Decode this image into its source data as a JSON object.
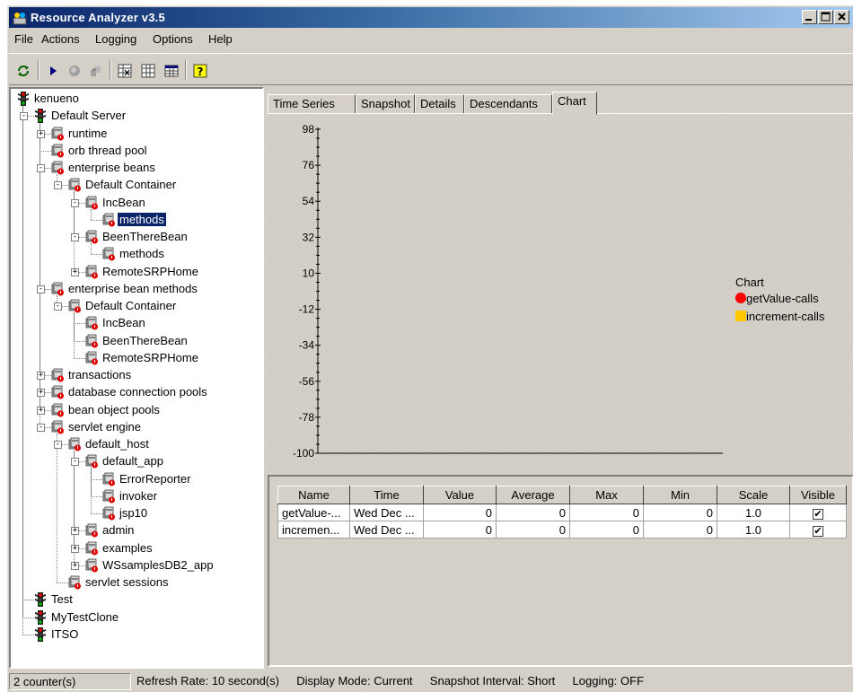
{
  "window": {
    "title": "Resource Analyzer v3.5"
  },
  "menu": [
    "File",
    "Actions",
    "Logging",
    "Options",
    "Help"
  ],
  "toolbar": [
    "refresh-icon",
    "play-icon",
    "stop-icon",
    "reset-icon",
    "table-icon",
    "table-clear-icon",
    "grid-icon",
    "help-icon"
  ],
  "tree": [
    {
      "label": "kenueno",
      "depth": 0,
      "icon": "traffic-light-icon",
      "expander": ""
    },
    {
      "label": "Default Server",
      "depth": 1,
      "icon": "traffic-light-icon",
      "expander": "-"
    },
    {
      "label": "runtime",
      "depth": 2,
      "icon": "resource-icon",
      "expander": "+"
    },
    {
      "label": "orb thread pool",
      "depth": 2,
      "icon": "resource-icon",
      "expander": ""
    },
    {
      "label": "enterprise beans",
      "depth": 2,
      "icon": "resource-icon",
      "expander": "-"
    },
    {
      "label": "Default Container",
      "depth": 3,
      "icon": "resource-icon",
      "expander": "-"
    },
    {
      "label": "IncBean",
      "depth": 4,
      "icon": "resource-icon",
      "expander": "-"
    },
    {
      "label": "methods",
      "depth": 5,
      "icon": "resource-icon",
      "expander": "",
      "selected": true
    },
    {
      "label": "BeenThereBean",
      "depth": 4,
      "icon": "resource-icon",
      "expander": "-"
    },
    {
      "label": "methods",
      "depth": 5,
      "icon": "resource-icon",
      "expander": ""
    },
    {
      "label": "RemoteSRPHome",
      "depth": 4,
      "icon": "resource-icon",
      "expander": "+"
    },
    {
      "label": "enterprise bean methods",
      "depth": 2,
      "icon": "resource-icon",
      "expander": "-"
    },
    {
      "label": "Default Container",
      "depth": 3,
      "icon": "resource-icon",
      "expander": "-"
    },
    {
      "label": "IncBean",
      "depth": 4,
      "icon": "resource-icon",
      "expander": ""
    },
    {
      "label": "BeenThereBean",
      "depth": 4,
      "icon": "resource-icon",
      "expander": ""
    },
    {
      "label": "RemoteSRPHome",
      "depth": 4,
      "icon": "resource-icon",
      "expander": ""
    },
    {
      "label": "transactions",
      "depth": 2,
      "icon": "resource-icon",
      "expander": "+"
    },
    {
      "label": "database connection pools",
      "depth": 2,
      "icon": "resource-icon",
      "expander": "+"
    },
    {
      "label": "bean object pools",
      "depth": 2,
      "icon": "resource-icon",
      "expander": "+"
    },
    {
      "label": "servlet engine",
      "depth": 2,
      "icon": "resource-icon",
      "expander": "-"
    },
    {
      "label": "default_host",
      "depth": 3,
      "icon": "resource-icon",
      "expander": "-"
    },
    {
      "label": "default_app",
      "depth": 4,
      "icon": "resource-icon",
      "expander": "-"
    },
    {
      "label": "ErrorReporter",
      "depth": 5,
      "icon": "resource-icon",
      "expander": ""
    },
    {
      "label": "invoker",
      "depth": 5,
      "icon": "resource-icon",
      "expander": ""
    },
    {
      "label": "jsp10",
      "depth": 5,
      "icon": "resource-icon",
      "expander": ""
    },
    {
      "label": "admin",
      "depth": 4,
      "icon": "resource-icon",
      "expander": "+"
    },
    {
      "label": "examples",
      "depth": 4,
      "icon": "resource-icon",
      "expander": "+"
    },
    {
      "label": "WSsamplesDB2_app",
      "depth": 4,
      "icon": "resource-icon",
      "expander": "+"
    },
    {
      "label": "servlet sessions",
      "depth": 3,
      "icon": "resource-icon",
      "expander": ""
    },
    {
      "label": "Test",
      "depth": 1,
      "icon": "traffic-light-icon",
      "expander": ""
    },
    {
      "label": "MyTestClone",
      "depth": 1,
      "icon": "traffic-light-icon",
      "expander": ""
    },
    {
      "label": "ITSO",
      "depth": 1,
      "icon": "traffic-light-icon",
      "expander": ""
    }
  ],
  "tabs": [
    {
      "label": "Time Series",
      "active": false
    },
    {
      "label": "Snapshot",
      "active": false
    },
    {
      "label": "Details",
      "active": false
    },
    {
      "label": "Descendants",
      "active": false
    },
    {
      "label": "Chart",
      "active": true
    }
  ],
  "chart_data": {
    "type": "line",
    "title": "",
    "xlabel": "",
    "ylabel": "",
    "ylim": [
      -100,
      98
    ],
    "yticks": [
      "98",
      "76",
      "54",
      "32",
      "10",
      "-12",
      "-34",
      "-56",
      "-78",
      "-100"
    ],
    "legend_title": "Chart",
    "legend_position": "right",
    "series": [
      {
        "name": "getValue-calls",
        "color": "#ff0000",
        "marker": "circle",
        "values": []
      },
      {
        "name": "increment-calls",
        "color": "#ffc800",
        "marker": "square",
        "values": []
      }
    ]
  },
  "table": {
    "columns": [
      "Name",
      "Time",
      "Value",
      "Average",
      "Max",
      "Min",
      "Scale",
      "Visible"
    ],
    "rows": [
      {
        "name": "getValue-...",
        "time": "Wed Dec ...",
        "value": "0",
        "average": "0",
        "max": "0",
        "min": "0",
        "scale": "1.0",
        "visible": true
      },
      {
        "name": "incremen...",
        "time": "Wed Dec ...",
        "value": "0",
        "average": "0",
        "max": "0",
        "min": "0",
        "scale": "1.0",
        "visible": true
      }
    ]
  },
  "status": {
    "counters": "2 counter(s)",
    "refresh": "Refresh Rate: 10 second(s)",
    "display_mode": "Display Mode: Current",
    "snapshot_interval": "Snapshot Interval: Short",
    "logging": "Logging: OFF"
  }
}
